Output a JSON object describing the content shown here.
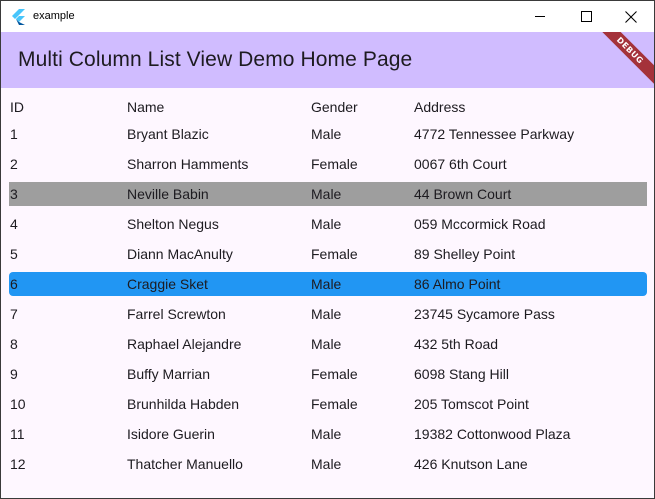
{
  "window": {
    "title": "example",
    "minimize_icon": "minimize-icon",
    "maximize_icon": "maximize-icon",
    "close_icon": "close-icon"
  },
  "appbar": {
    "title": "Multi Column List View Demo Home Page",
    "debug_label": "DEBUG",
    "background": "#d0bcff"
  },
  "table": {
    "columns": [
      "ID",
      "Name",
      "Gender",
      "Address"
    ],
    "rows": [
      {
        "id": "1",
        "name": "Bryant Blazic",
        "gender": "Male",
        "address": "4772 Tennessee Parkway",
        "state": "normal"
      },
      {
        "id": "2",
        "name": "Sharron Hamments",
        "gender": "Female",
        "address": "0067 6th Court",
        "state": "normal"
      },
      {
        "id": "3",
        "name": "Neville Babin",
        "gender": "Male",
        "address": "44 Brown Court",
        "state": "highlighted"
      },
      {
        "id": "4",
        "name": "Shelton Negus",
        "gender": "Male",
        "address": "059 Mccormick Road",
        "state": "normal"
      },
      {
        "id": "5",
        "name": "Diann MacAnulty",
        "gender": "Female",
        "address": "89 Shelley Point",
        "state": "normal"
      },
      {
        "id": "6",
        "name": "Craggie Sket",
        "gender": "Male",
        "address": "86 Almo Point",
        "state": "selected"
      },
      {
        "id": "7",
        "name": "Farrel Screwton",
        "gender": "Male",
        "address": "23745 Sycamore Pass",
        "state": "normal"
      },
      {
        "id": "8",
        "name": "Raphael Alejandre",
        "gender": "Male",
        "address": "432 5th Road",
        "state": "normal"
      },
      {
        "id": "9",
        "name": "Buffy Marrian",
        "gender": "Female",
        "address": "6098 Stang Hill",
        "state": "normal"
      },
      {
        "id": "10",
        "name": "Brunhilda Habden",
        "gender": "Female",
        "address": "205 Tomscot Point",
        "state": "normal"
      },
      {
        "id": "11",
        "name": "Isidore Guerin",
        "gender": "Male",
        "address": "19382 Cottonwood Plaza",
        "state": "normal"
      },
      {
        "id": "12",
        "name": "Thatcher Manuello",
        "gender": "Male",
        "address": "426 Knutson Lane",
        "state": "normal"
      }
    ],
    "highlight_color": "#9e9e9e",
    "selected_color": "#2196f3"
  }
}
